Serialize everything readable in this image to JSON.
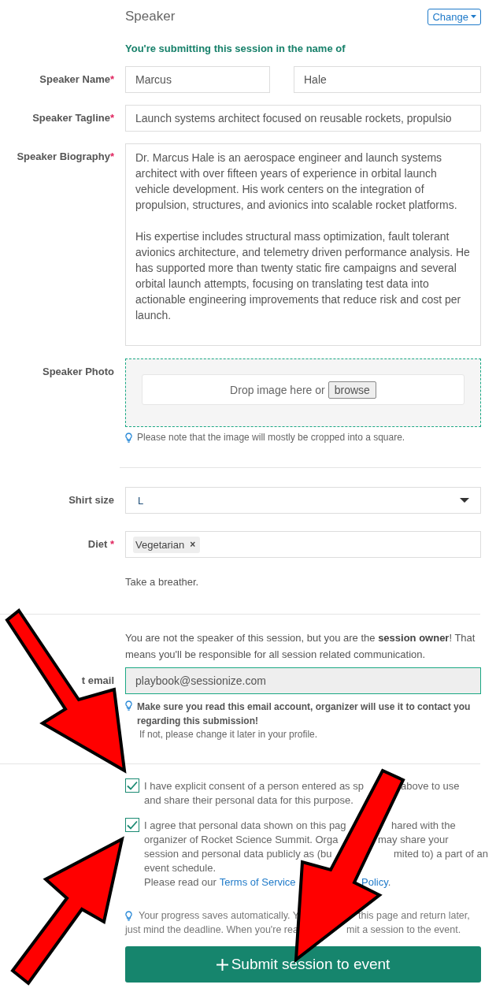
{
  "section_title": "Speaker",
  "change_button": "Change",
  "intro": "You're submitting this session in the name of",
  "speaker_name": {
    "label": "Speaker Name",
    "mark": "*",
    "values": [
      "Marcus",
      "Hale"
    ]
  },
  "speaker_tagline": {
    "label": "Speaker Tagline",
    "mark": "*",
    "value": "Launch systems architect focused on reusable rockets, propulsio"
  },
  "speaker_biography": {
    "label": "Speaker Biography",
    "mark": "*",
    "value": "Dr. Marcus Hale is an aerospace engineer and launch systems architect with over fifteen years of experience in orbital launch vehicle development. His work centers on the integration of propulsion, structures, and avionics into scalable rocket platforms.\n\nHis expertise includes structural mass optimization, fault tolerant avionics architecture, and telemetry driven performance analysis. He has supported more than twenty static fire campaigns and several orbital launch attempts, focusing on translating test data into actionable engineering improvements that reduce risk and cost per launch."
  },
  "speaker_photo": {
    "label": "Speaker Photo",
    "drop_text": "Drop image here or",
    "browse_button": "browse",
    "hint": "Please note that the image will mostly be cropped into a square."
  },
  "shirt_size": {
    "label": "Shirt size",
    "value": "L"
  },
  "diet": {
    "label": "Diet",
    "mark": " *",
    "tags": [
      {
        "text": "Vegetarian",
        "remove": "×"
      }
    ]
  },
  "breather": "Take a breather.",
  "owner_note": "You are not the speaker of this session, but you are the **session owner**! That means you'll be responsible for all session related communication.",
  "contact_email": {
    "label": "t email",
    "value": "playbook@sessionize.com",
    "hint_bold": "Make sure you read this email account, organizer will use it to contact you regarding this submission!",
    "hint": "If not, please change it later in your profile."
  },
  "consents": [
    {
      "checked": true,
      "lines": [
        {
          "left": [
            {
              "kind": "text",
              "text": "I have explicit consent of a person entered as sp"
            }
          ],
          "right": [
            {
              "kind": "text",
              "text": "above to use"
            }
          ]
        },
        {
          "left": [
            {
              "kind": "text",
              "text": "and share their personal data for this purpose."
            }
          ]
        }
      ]
    },
    {
      "checked": true,
      "lines": [
        {
          "left": [
            {
              "kind": "text",
              "text": "I agree that personal data shown on this pag"
            }
          ],
          "right": [
            {
              "kind": "text",
              "text": "hared with the"
            }
          ]
        },
        {
          "left": [
            {
              "kind": "text",
              "text": "organizer of Rocket Science Summit. Orga"
            }
          ],
          "right": [
            {
              "kind": "text",
              "text": "may share your"
            }
          ]
        },
        {
          "left": [
            {
              "kind": "text",
              "text": "session and personal data publicly as (bu"
            }
          ],
          "right": [
            {
              "kind": "text",
              "text": "mited to) a part of an"
            }
          ]
        },
        {
          "left": [
            {
              "kind": "text",
              "text": "event schedule."
            }
          ]
        },
        {
          "left": [
            {
              "kind": "text",
              "text": "Please read our"
            },
            {
              "kind": "link",
              "text": "Terms of Service"
            }
          ],
          "right": [
            {
              "kind": "link",
              "text": "Policy"
            },
            {
              "kind": "text",
              "text": "."
            }
          ]
        }
      ]
    }
  ],
  "progress": {
    "lines": [
      {
        "left": [
          {
            "kind": "text",
            "text": "Your progress saves automatically. Y"
          }
        ],
        "right": [
          {
            "kind": "text",
            "text": "this page and return later,"
          }
        ]
      },
      {
        "left": [
          {
            "kind": "text",
            "text": "just mind the deadline. When you're rea"
          }
        ],
        "right": [
          {
            "kind": "text",
            "text": "mit a session to the event."
          }
        ]
      }
    ]
  },
  "submit_button": "Submit session to event"
}
